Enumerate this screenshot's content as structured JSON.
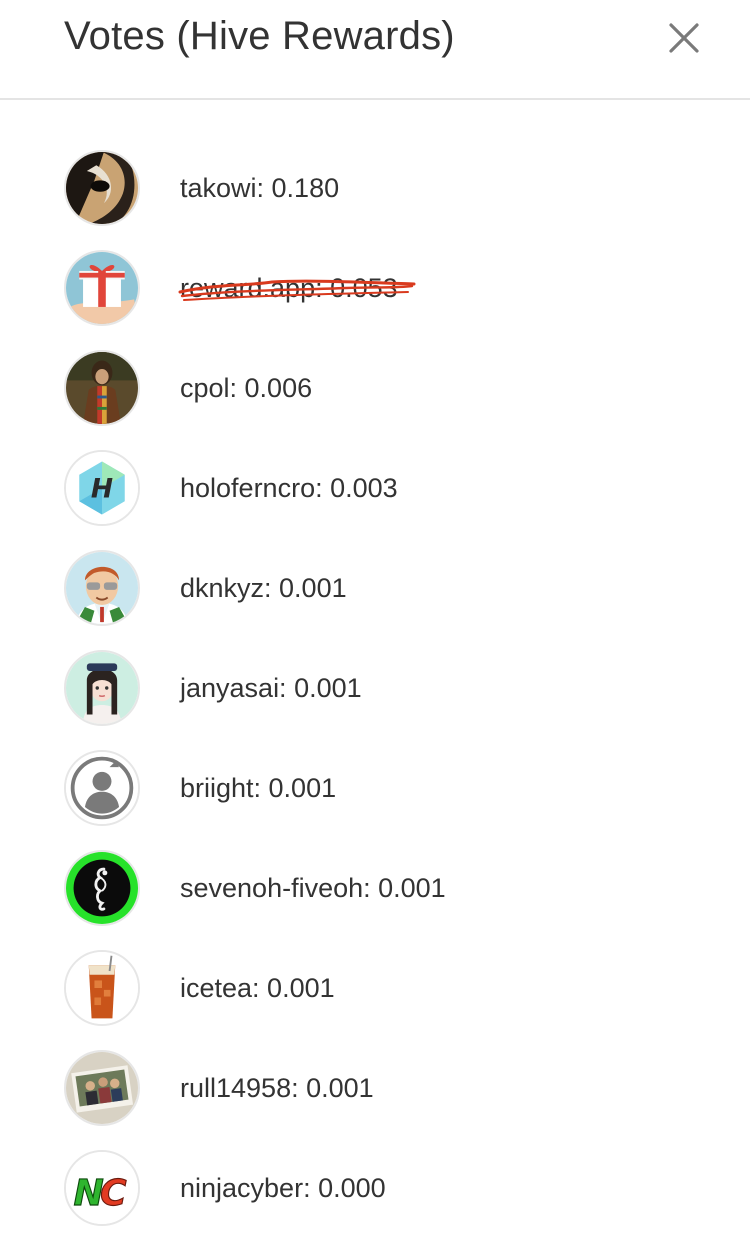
{
  "header": {
    "title": "Votes (Hive Rewards)",
    "close_icon": "close-icon"
  },
  "votes": [
    {
      "user": "takowi",
      "value": "0.180",
      "text": "takowi: 0.180",
      "avatar": "takowi-avatar"
    },
    {
      "user": "reward.app",
      "value": "0.053",
      "text": "reward.app: 0.053",
      "avatar": "gift-avatar",
      "struck": true
    },
    {
      "user": "cpol",
      "value": "0.006",
      "text": "cpol: 0.006",
      "avatar": "cpol-avatar"
    },
    {
      "user": "holoferncro",
      "value": "0.003",
      "text": "holoferncro: 0.003",
      "avatar": "hexagon-h-avatar"
    },
    {
      "user": "dknkyz",
      "value": "0.001",
      "text": "dknkyz: 0.001",
      "avatar": "cartoon-man-avatar"
    },
    {
      "user": "janyasai",
      "value": "0.001",
      "text": "janyasai: 0.001",
      "avatar": "cartoon-girl-avatar"
    },
    {
      "user": "briight",
      "value": "0.001",
      "text": "briight: 0.001",
      "avatar": "default-user-avatar"
    },
    {
      "user": "sevenoh-fiveoh",
      "value": "0.001",
      "text": "sevenoh-fiveoh: 0.001",
      "avatar": "seahorse-avatar"
    },
    {
      "user": "icetea",
      "value": "0.001",
      "text": "icetea: 0.001",
      "avatar": "iced-tea-avatar"
    },
    {
      "user": "rull14958",
      "value": "0.001",
      "text": "rull14958: 0.001",
      "avatar": "photo-avatar"
    },
    {
      "user": "ninjacyber",
      "value": "0.000",
      "text": "ninjacyber: 0.000",
      "avatar": "nc-logo-avatar"
    }
  ],
  "colors": {
    "title": "#333333",
    "text": "#333333",
    "divider": "#e4e4e4",
    "scribble": "#d93a1e"
  }
}
